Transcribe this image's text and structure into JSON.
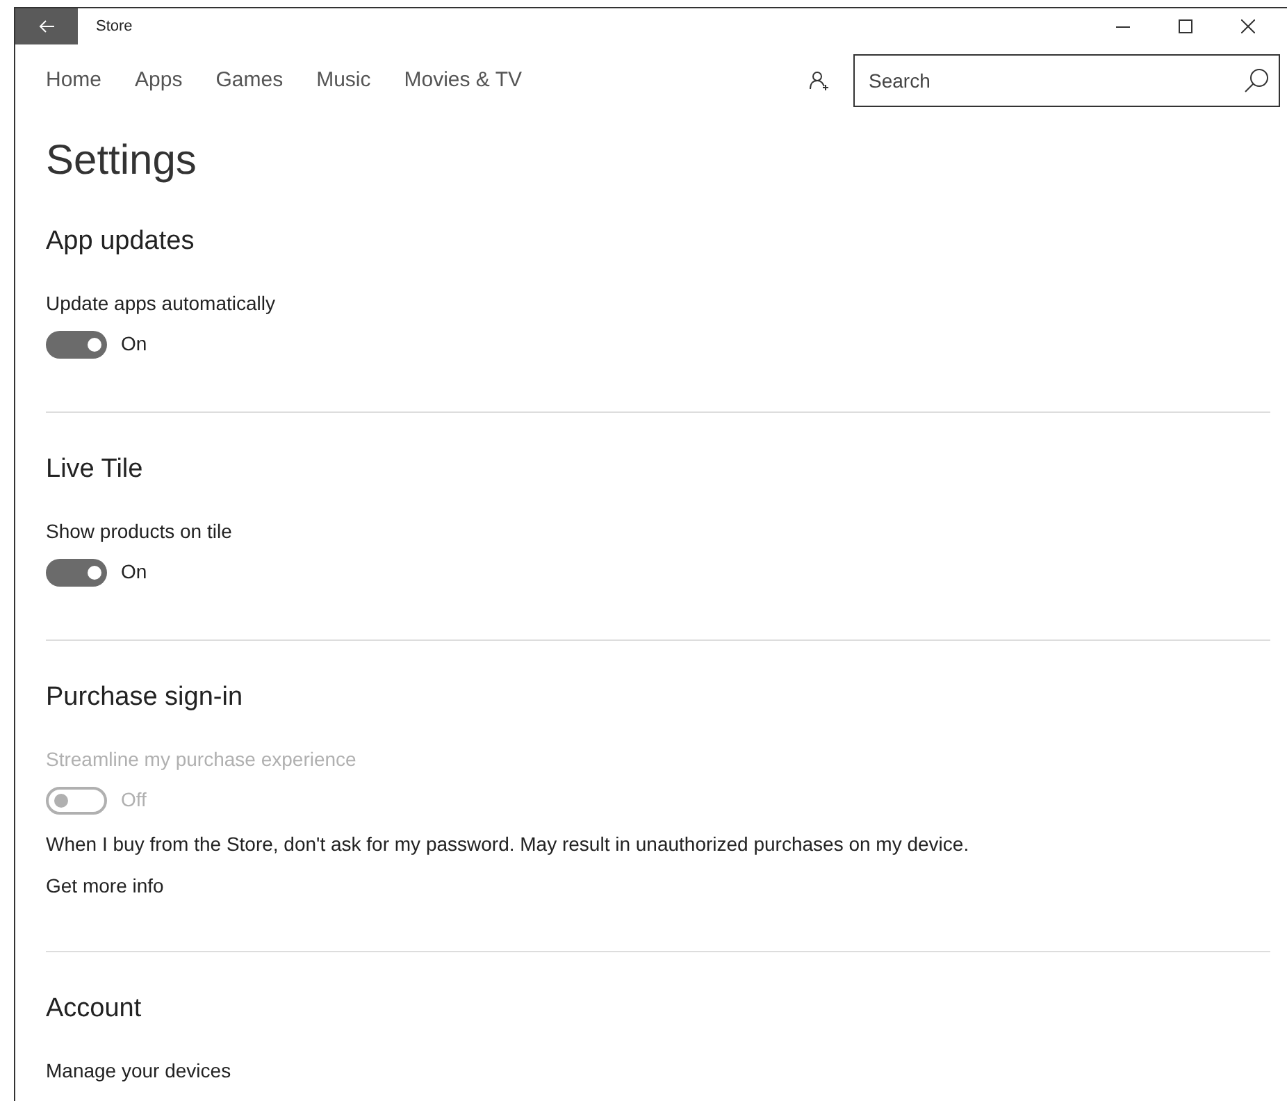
{
  "window": {
    "title": "Store"
  },
  "nav": [
    {
      "label": "Home"
    },
    {
      "label": "Apps"
    },
    {
      "label": "Games"
    },
    {
      "label": "Music"
    },
    {
      "label": "Movies & TV"
    }
  ],
  "search": {
    "placeholder": "Search"
  },
  "page_title": "Settings",
  "sections": [
    {
      "title": "App updates",
      "items": [
        {
          "kind": "toggle",
          "label": "Update apps automatically",
          "on": true,
          "disabled": false,
          "state_text": "On"
        }
      ]
    },
    {
      "title": "Live Tile",
      "items": [
        {
          "kind": "toggle",
          "label": "Show products on tile",
          "on": true,
          "disabled": false,
          "state_text": "On"
        }
      ]
    },
    {
      "title": "Purchase sign-in",
      "items": [
        {
          "kind": "toggle",
          "label": "Streamline my purchase experience",
          "on": false,
          "disabled": true,
          "state_text": "Off"
        },
        {
          "kind": "text",
          "text": "When I buy from the Store, don't ask for my password. May result in unauthorized purchases on my device."
        },
        {
          "kind": "link",
          "text": "Get more info"
        }
      ]
    },
    {
      "title": "Account",
      "items": [
        {
          "kind": "link",
          "text": "Manage your devices"
        }
      ]
    }
  ]
}
